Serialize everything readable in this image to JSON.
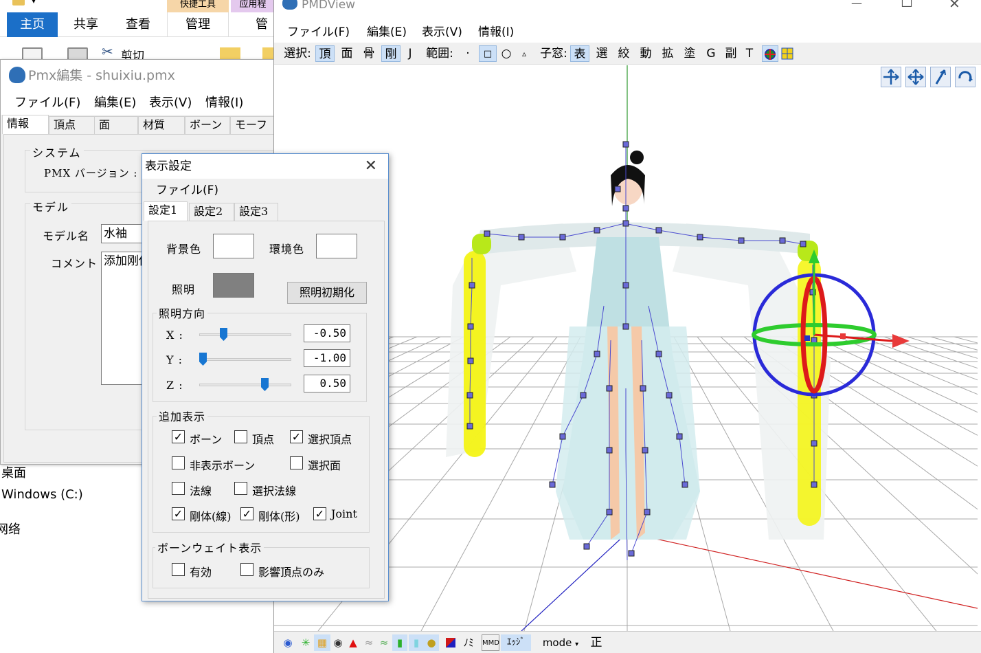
{
  "explorer": {
    "tools_header_1": "快捷工具",
    "tools_header_2": "应用程",
    "tabs": [
      "主页",
      "共享",
      "查看",
      "管理",
      "管"
    ],
    "cut_label": "剪切",
    "nav_items": [
      "桌面",
      "Windows (C:)",
      "网络"
    ]
  },
  "pmx_window": {
    "title": "Pmx編集 - shuixiu.pmx",
    "menu": [
      "ファイル(F)",
      "編集(E)",
      "表示(V)",
      "情報(I)"
    ],
    "tabs": [
      "情報",
      "頂点",
      "面",
      "材質",
      "ボーン",
      "モーフ"
    ],
    "system_group": "システム",
    "pmx_version_label": "PMX バージョン :",
    "model_group": "モデル",
    "model_name_label": "モデル名",
    "model_name_value": "水袖",
    "comment_label": "コメント",
    "comment_value": "添加刚体"
  },
  "dialog": {
    "title": "表示設定",
    "close_icon": "close-icon",
    "menu_file": "ファイル(F)",
    "tabs": [
      "設定1",
      "設定2",
      "設定3"
    ],
    "bg_color_label": "背景色",
    "env_color_label": "環境色",
    "light_label": "照明",
    "light_color": "#808080",
    "light_reset_button": "照明初期化",
    "light_dir_group": "照明方向",
    "sliders": [
      {
        "axis": "X :",
        "value": "-0.50",
        "ratio": 0.25
      },
      {
        "axis": "Y :",
        "value": "-1.00",
        "ratio": 0.0
      },
      {
        "axis": "Z :",
        "value": "0.50",
        "ratio": 0.75
      }
    ],
    "extra_group": "追加表示",
    "checkboxes": [
      {
        "label": "ボーン",
        "checked": true
      },
      {
        "label": "頂点",
        "checked": false
      },
      {
        "label": "選択頂点",
        "checked": true
      },
      {
        "label": "非表示ボーン",
        "checked": false
      },
      {
        "label": "選択面",
        "checked": false
      },
      {
        "label": "法線",
        "checked": false
      },
      {
        "label": "選択法線",
        "checked": false
      },
      {
        "label": "剛体(線)",
        "checked": true
      },
      {
        "label": "剛体(形)",
        "checked": true
      },
      {
        "label": "Joint",
        "checked": true
      }
    ],
    "weight_group": "ボーンウェイト表示",
    "weight_checkboxes": [
      {
        "label": "有効",
        "checked": false
      },
      {
        "label": "影響頂点のみ",
        "checked": false
      }
    ],
    "check_mark": "✓"
  },
  "pmd_window": {
    "title": "PMDView",
    "minimize_icon": "—",
    "maximize_icon": "☐",
    "close_icon": "✕",
    "menu": [
      "ファイル(F)",
      "編集(E)",
      "表示(V)",
      "情報(I)"
    ],
    "toolbar": {
      "select_label": "選択:",
      "select_items": [
        "頂",
        "面",
        "骨",
        "剛",
        "J"
      ],
      "range_label": "範囲:",
      "range_items": [
        "·",
        "□",
        "○",
        "▵"
      ],
      "child_label": "子窓:",
      "child_items": [
        "表",
        "選",
        "絞",
        "動",
        "拡",
        "塗",
        "G",
        "副",
        "T"
      ]
    },
    "view_buttons": [
      "move-xyz-icon",
      "move-icon",
      "local-axis-icon",
      "rotate-icon"
    ],
    "status": {
      "mode_label": "mode",
      "edge_label": "ｴｯｼﾞ",
      "mmd_label": "MMD",
      "no_label": "ﾉﾐ",
      "front_label": "正"
    }
  }
}
